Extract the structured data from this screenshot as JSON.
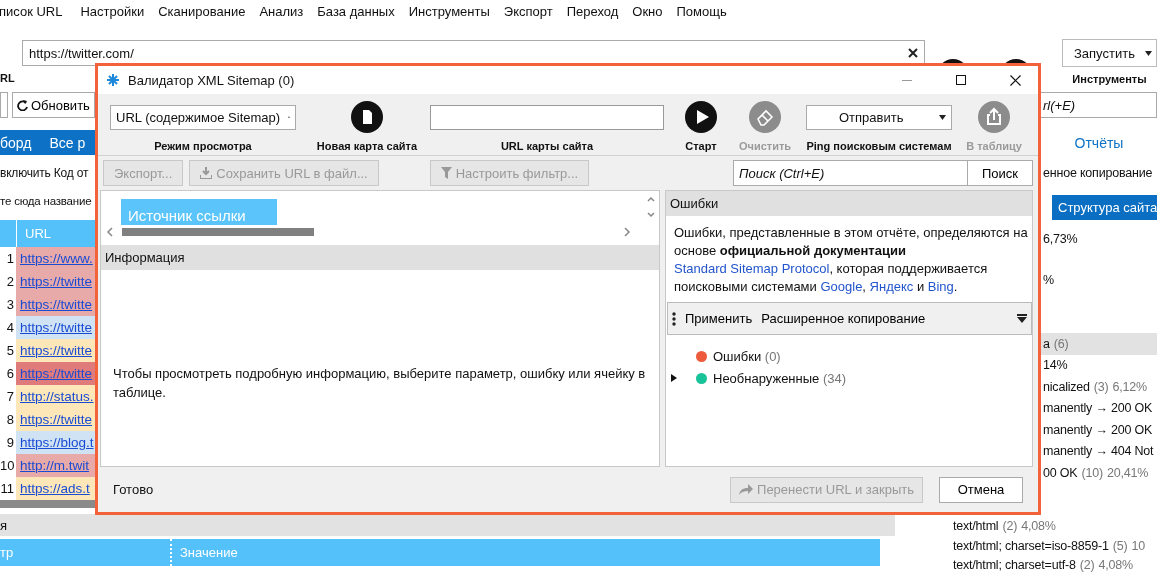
{
  "menu": [
    "писок URL",
    "Настройки",
    "Сканирование",
    "Анализ",
    "База данных",
    "Инструменты",
    "Экспорт",
    "Переход",
    "Окно",
    "Помощь"
  ],
  "address": {
    "value": "https://twitter.com/",
    "url_label": "RL"
  },
  "run": {
    "select": "Запустить",
    "label": "Инструменты"
  },
  "left": {
    "refresh_button": "Обновить",
    "tabs": [
      {
        "label": "борд",
        "selected": false
      },
      {
        "label": "Все р",
        "selected": false
      }
    ],
    "filter_text": "включить Код от",
    "drop_hint": "те сюда название",
    "table": {
      "columns": [
        "URL"
      ],
      "rows": [
        {
          "number": "1",
          "url": "https://www.",
          "color": "#e8a9a9"
        },
        {
          "number": "2",
          "url": "https://twitte",
          "color": "#e8a9a9"
        },
        {
          "number": "3",
          "url": "https://twitte",
          "color": "#e8a9a9"
        },
        {
          "number": "4",
          "url": "https://twitte",
          "color": "#cfe3f5"
        },
        {
          "number": "5",
          "url": "https://twitte",
          "color": "#fde7b8"
        },
        {
          "number": "6",
          "url": "https://twitte",
          "color": "#e07b7b"
        },
        {
          "number": "7",
          "url": "http://status.",
          "color": "#fde7b8"
        },
        {
          "number": "8",
          "url": "https://twitte",
          "color": "#fde7b8"
        },
        {
          "number": "9",
          "url": "https://blog.t",
          "color": "#cfe3f5"
        },
        {
          "number": "10",
          "url": "http://m.twit",
          "color": "#e8a9a9"
        },
        {
          "number": "11",
          "url": "https://ads.t",
          "color": "#fde7b8"
        }
      ]
    }
  },
  "right": {
    "search_placeholder": "rl(+E)",
    "reports_tab": "Отчёты",
    "copy_label": "енное копирование",
    "structure_tab": "Структура сайта",
    "groups": [
      {
        "rows": [
          {
            "kind": "item",
            "label": "6,73%"
          }
        ]
      },
      {
        "rows": [
          {
            "kind": "item",
            "label": "%"
          }
        ]
      },
      {
        "rows": [
          {
            "kind": "header",
            "label": "а",
            "count": "(6)"
          },
          {
            "kind": "item",
            "label": "14%"
          },
          {
            "kind": "item",
            "label": "nicalized",
            "count": "(3)",
            "share": "6,12%"
          },
          {
            "kind": "item",
            "label": "manently → 200 OK"
          },
          {
            "kind": "item",
            "label": "manently → 200 OK"
          },
          {
            "kind": "item",
            "label": "manently → 404 Not"
          },
          {
            "kind": "item",
            "label": "00 OK",
            "count": "(10)",
            "share": "20,41%"
          }
        ]
      },
      {
        "rows": [
          {
            "kind": "sub",
            "label": "text/html",
            "count": "(2)",
            "share": "4,08%"
          },
          {
            "kind": "sub",
            "label": "text/html; charset=iso-8859-1",
            "count": "(5)",
            "share": "10"
          },
          {
            "kind": "sub",
            "label": "text/html; charset=utf-8",
            "count": "(2)",
            "share": "4,08%"
          }
        ]
      }
    ]
  },
  "bottom": {
    "title": "я",
    "columns": [
      "тр",
      "Значение"
    ]
  },
  "dialog": {
    "title": "Валидатор XML Sitemap (0)",
    "toolbar": {
      "mode": {
        "value": "URL (содержимое Sitemap)",
        "label": "Режим просмотра"
      },
      "new_map": {
        "label": "Новая карта сайта"
      },
      "url": {
        "label": "URL карты сайта"
      },
      "start": {
        "label": "Старт",
        "disabled": false
      },
      "clear": {
        "label": "Очистить",
        "disabled": true
      },
      "ping": {
        "value": "Отправить",
        "label": "Ping поисковым системам"
      },
      "to_table": {
        "label": "В таблицу",
        "disabled": true
      }
    },
    "actions": [
      {
        "kind": "plain",
        "label": "Экспорт...",
        "disabled": true
      },
      {
        "kind": "download",
        "label": "Сохранить URL в файл...",
        "disabled": true
      },
      {
        "kind": "filter",
        "label": "Настроить фильтр...",
        "disabled": true
      }
    ],
    "search": {
      "placeholder": "Поиск (Ctrl+E)",
      "button": "Поиск"
    },
    "source_tab": "Источник ссылки",
    "info": {
      "title": "Информация",
      "text": "Чтобы просмотреть подробную информацию, выберите параметр, ошибку или ячейку в таблице."
    },
    "errors": {
      "title": "Ошибки",
      "description": [
        {
          "kind": "text",
          "text": "Ошибки, представленные в этом отчёте, определяются на основе **официальной документации** "
        },
        {
          "kind": "link",
          "text": "Standard Sitemap Protocol"
        },
        {
          "kind": "text",
          "text": ", которая поддерживается поисковыми системами "
        },
        {
          "kind": "link",
          "text": "Google"
        },
        {
          "kind": "text",
          "text": ", "
        },
        {
          "kind": "link",
          "text": "Яндекс"
        },
        {
          "kind": "text",
          "text": " и "
        },
        {
          "kind": "link",
          "text": "Bing"
        },
        {
          "kind": "text",
          "text": "."
        }
      ],
      "toolbar": {
        "apply": "Применить",
        "copy": "Расширенное копирование"
      },
      "tree": [
        {
          "label": "Ошибки",
          "count": "(0)",
          "color": "#ee5a3c",
          "expandable": false
        },
        {
          "label": "Необнаруженные",
          "count": "(34)",
          "color": "#19c39a",
          "expandable": true
        }
      ]
    },
    "footer": {
      "status": "Готово",
      "transfer": {
        "label": "Перенести URL и закрыть",
        "disabled": true
      },
      "cancel": "Отмена"
    }
  }
}
